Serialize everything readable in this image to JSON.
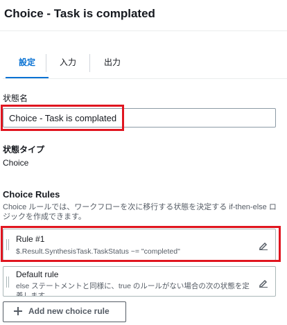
{
  "header": {
    "title": "Choice - Task is complated"
  },
  "tabs": [
    {
      "label": "設定",
      "active": true
    },
    {
      "label": "入力",
      "active": false
    },
    {
      "label": "出力",
      "active": false
    }
  ],
  "state_name": {
    "label": "状態名",
    "value": "Choice - Task is complated"
  },
  "state_type": {
    "label": "状態タイプ",
    "value": "Choice"
  },
  "choice_rules": {
    "heading": "Choice Rules",
    "description": "Choice ルールでは、ワークフローを次に移行する状態を決定する if-then-else ロジックを作成できます。",
    "rules": [
      {
        "title": "Rule #1",
        "condition": "$.Result.SynthesisTask.TaskStatus ~= \"completed\""
      },
      {
        "title": "Default rule",
        "condition": "else ステートメントと同様に、true のルールがない場合の次の状態を定義します。"
      }
    ],
    "add_button_label": "Add new choice rule"
  },
  "colors": {
    "accent": "#0972d3",
    "highlight": "#e0151f"
  },
  "icons": {
    "edit": "pencil-icon",
    "drag": "drag-handle-icon",
    "add": "plus-icon"
  }
}
